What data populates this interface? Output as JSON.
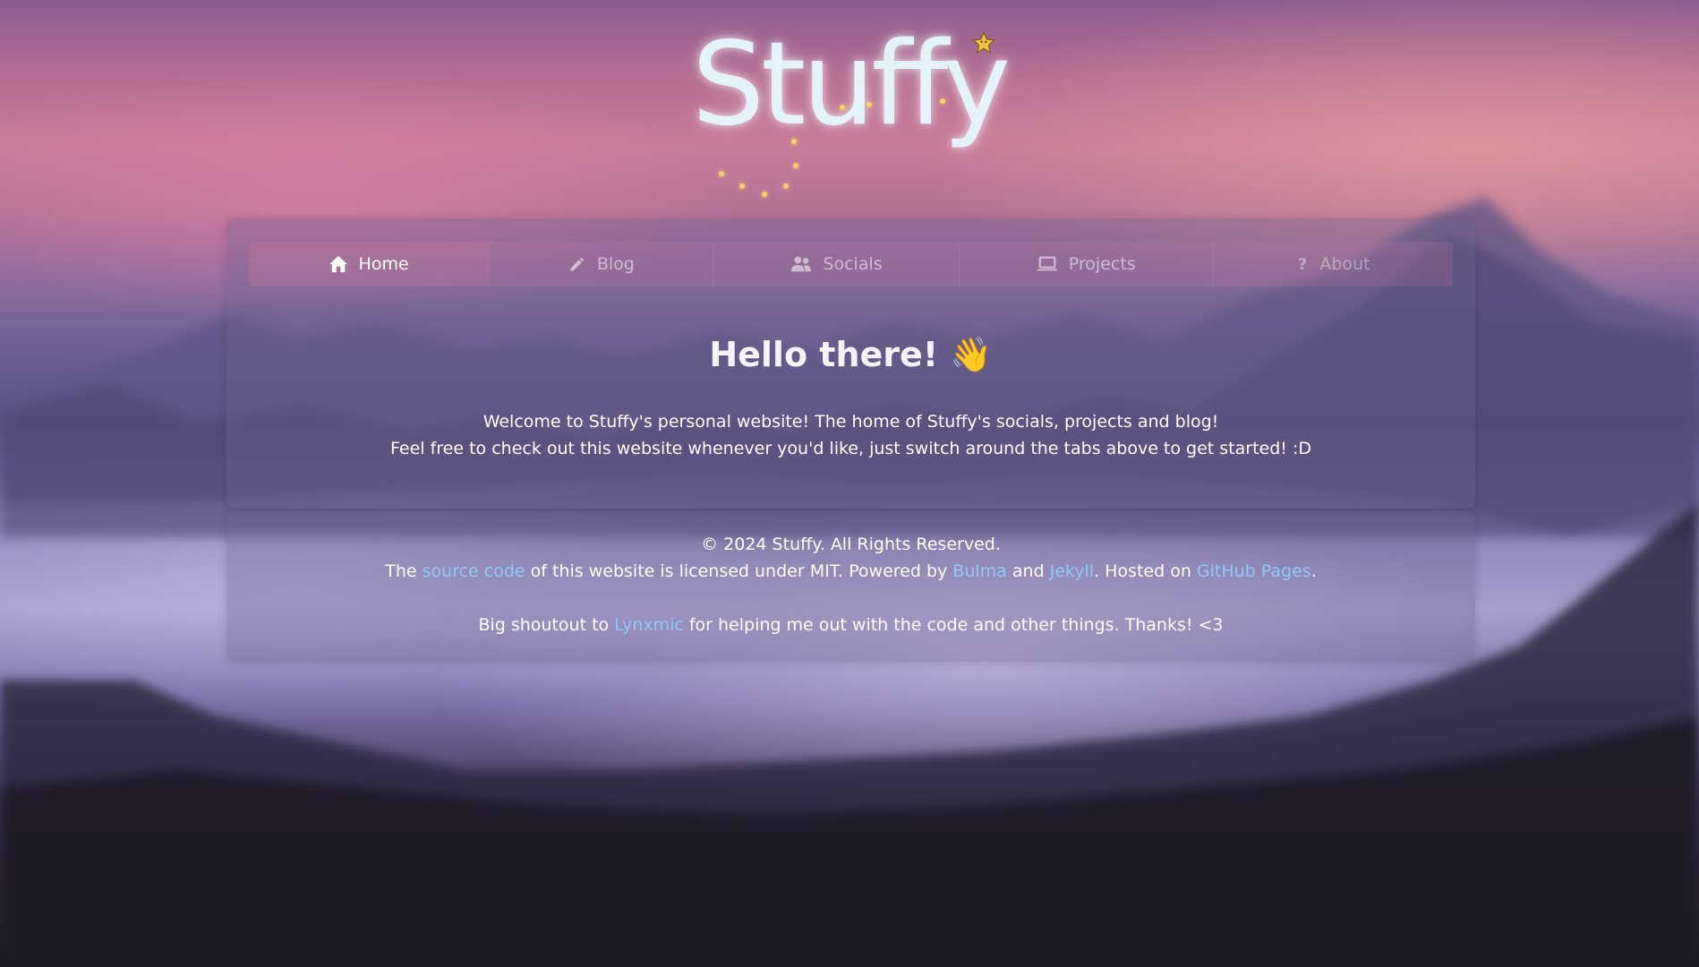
{
  "logo": {
    "text": "Stuffy"
  },
  "nav": {
    "tabs": [
      {
        "label": "Home",
        "icon": "home-icon",
        "active": true
      },
      {
        "label": "Blog",
        "icon": "pencil-icon",
        "active": false
      },
      {
        "label": "Socials",
        "icon": "users-icon",
        "active": false
      },
      {
        "label": "Projects",
        "icon": "laptop-icon",
        "active": false
      },
      {
        "label": "About",
        "icon": "question-icon",
        "active": false
      }
    ]
  },
  "main": {
    "heading": "Hello there! 👋",
    "line1": "Welcome to Stuffy's personal website! The home of Stuffy's socials, projects and blog!",
    "line2": "Feel free to check out this website whenever you'd like, just switch around the tabs above to get started! :D"
  },
  "footer": {
    "copyright": "© 2024 Stuffy. All Rights Reserved.",
    "license_pre": "The ",
    "source_link": "source code",
    "license_mid": " of this website is licensed under MIT. Powered by ",
    "bulma_link": "Bulma",
    "and_text": " and ",
    "jekyll_link": "Jekyll",
    "hosted_text": ". Hosted on ",
    "github_link": "GitHub Pages",
    "period": ".",
    "shout_pre": "Big shoutout to ",
    "lynxmic_link": "Lynxmic",
    "shout_post": " for helping me out with the code and other things. Thanks! <3"
  },
  "colors": {
    "link": "#8ecbf5",
    "logo": "#e4f2fb",
    "star": "#f5c542"
  }
}
